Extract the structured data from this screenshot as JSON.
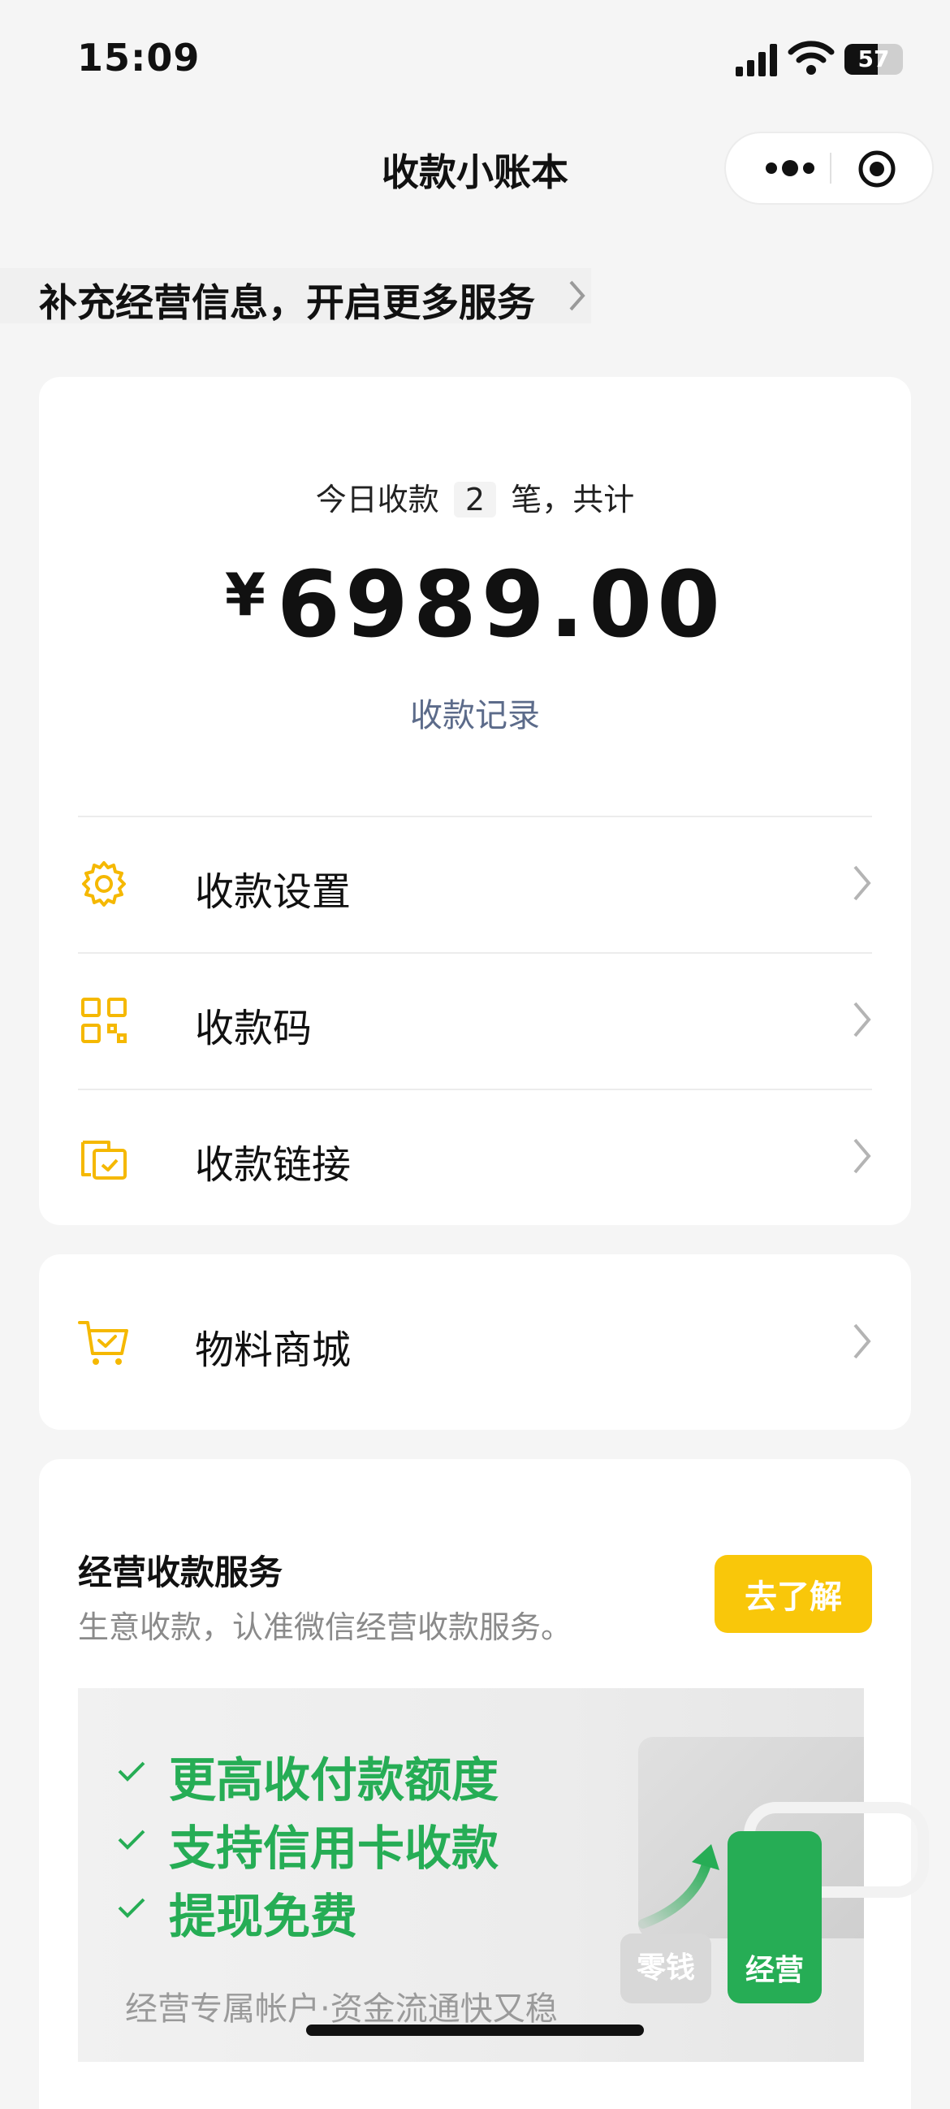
{
  "status_bar": {
    "time": "15:09",
    "battery": "57",
    "battery_level": 0.57
  },
  "nav": {
    "title": "收款小账本"
  },
  "banner": {
    "text": "补充经营信息，开启更多服务"
  },
  "summary": {
    "prefix": "今日收款",
    "count": "2",
    "suffix": "笔，共计",
    "currency": "¥",
    "amount": "6989.00",
    "record_link": "收款记录"
  },
  "menu": [
    {
      "label": "收款设置",
      "icon": "gear-icon"
    },
    {
      "label": "收款码",
      "icon": "qr-code-icon"
    },
    {
      "label": "收款链接",
      "icon": "link-doc-icon"
    }
  ],
  "mall": {
    "label": "物料商城",
    "icon": "cart-icon"
  },
  "service": {
    "title": "经营收款服务",
    "subtitle": "生意收款，认准微信经营收款服务。",
    "button": "去了解",
    "features": [
      "更高收付款额度",
      "支持信用卡收款",
      "提现免费"
    ],
    "footer": "经营专属帐户·资金流通快又稳",
    "pill_change": "零钱",
    "pill_business": "经营"
  },
  "colors": {
    "accent": "#f9c70a",
    "green": "#26ad55",
    "link": "#5c6b8a"
  }
}
